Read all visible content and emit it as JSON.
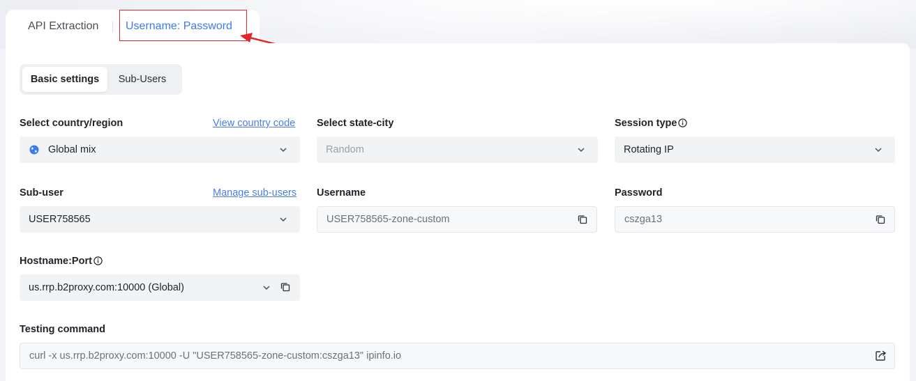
{
  "tabs": {
    "api": "API Extraction",
    "userpass": "Username: Password"
  },
  "segmented": {
    "basic": "Basic settings",
    "sub": "Sub-Users"
  },
  "country": {
    "label": "Select country/region",
    "link": "View country code",
    "value": "Global mix"
  },
  "state": {
    "label": "Select state-city",
    "placeholder": "Random"
  },
  "session": {
    "label": "Session type",
    "value": "Rotating IP"
  },
  "subuser": {
    "label": "Sub-user",
    "link": "Manage sub-users",
    "value": "USER758565"
  },
  "username": {
    "label": "Username",
    "value": "USER758565-zone-custom"
  },
  "password": {
    "label": "Password",
    "value": "cszga13"
  },
  "hostname": {
    "label": "Hostname:Port",
    "value": "us.rrp.b2proxy.com:10000 (Global)"
  },
  "testing": {
    "label": "Testing command",
    "value": "curl -x us.rrp.b2proxy.com:10000 -U \"USER758565-zone-custom:cszga13\" ipinfo.io"
  },
  "colors": {
    "accent": "#3b7bf0",
    "highlight": "#e0282c",
    "link": "#4a7ee8"
  }
}
